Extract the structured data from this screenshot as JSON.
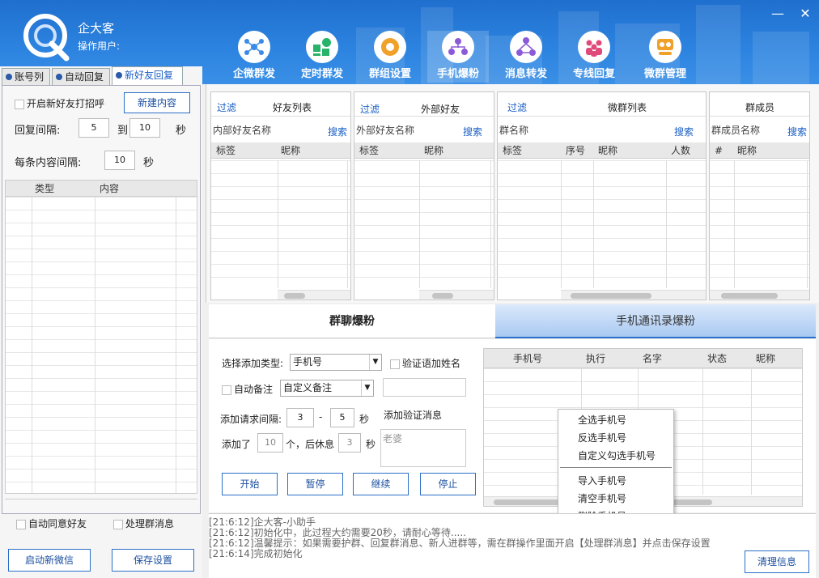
{
  "app": {
    "title": "企大客",
    "operator_label": "操作用户:",
    "minimize": "—",
    "close": "✕"
  },
  "nav": [
    {
      "label": "企微群发",
      "icon": "network-icon",
      "color": "#3a8be8"
    },
    {
      "label": "定时群发",
      "icon": "clock-grid-icon",
      "color": "#27b36a"
    },
    {
      "label": "群组设置",
      "icon": "gear-icon",
      "color": "#f0a12a"
    },
    {
      "label": "手机爆粉",
      "icon": "people-tree-icon",
      "color": "#8a5ad8"
    },
    {
      "label": "消息转发",
      "icon": "share-icon",
      "color": "#8a5ad8"
    },
    {
      "label": "专线回复",
      "icon": "team-icon",
      "color": "#e04a7a"
    },
    {
      "label": "微群管理",
      "icon": "group-manage-icon",
      "color": "#f0a12a"
    }
  ],
  "left": {
    "tabs": [
      "账号列",
      "自动回复",
      "新好友回复"
    ],
    "enable_greeting": "开启新好友打招呼",
    "new_content_button": "新建内容",
    "reply_interval_label": "回复间隔:",
    "reply_from": "5",
    "to_label": "到",
    "reply_to": "10",
    "sec": "秒",
    "content_interval_label": "每条内容间隔:",
    "content_interval": "10",
    "columns": [
      "类型",
      "内容"
    ],
    "auto_accept": "自动同意好友",
    "handle_group_msg": "处理群消息",
    "start_wechat": "启动新微信",
    "save_settings": "保存设置"
  },
  "panels": {
    "friends": {
      "filter": "过滤",
      "title": "好友列表",
      "search_label": "内部好友名称",
      "search": "搜索",
      "columns": [
        "标签",
        "昵称"
      ]
    },
    "external": {
      "filter": "过滤",
      "title": "外部好友",
      "search_label": "外部好友名称",
      "search": "搜索",
      "columns": [
        "标签",
        "昵称"
      ]
    },
    "groups": {
      "filter": "过滤",
      "title": "微群列表",
      "search_label": "群名称",
      "search": "搜索",
      "columns": [
        "标签",
        "序号",
        "昵称",
        "人数"
      ]
    },
    "members": {
      "title": "群成员",
      "search_label": "群成员名称",
      "search": "搜索",
      "columns": [
        "#",
        "昵称"
      ]
    }
  },
  "bottom_tabs": [
    "群聊爆粉",
    "手机通讯录爆粉"
  ],
  "form": {
    "add_type_label": "选择添加类型:",
    "add_type_value": "手机号",
    "verify_add_name": "验证语加姓名",
    "auto_remark": "自动备注",
    "remark_value": "自定义备注",
    "interval_label": "添加请求间隔:",
    "interval_from": "3",
    "dash": "-",
    "interval_to": "5",
    "sec": "秒",
    "verify_msg_label": "添加验证消息",
    "added_label": "添加了",
    "added_count": "10",
    "rest_label": "个，后休息",
    "rest_value": "3",
    "verify_msg_value": "老婆",
    "buttons": [
      "开始",
      "暂停",
      "继续",
      "停止"
    ]
  },
  "phone_table": {
    "columns": [
      "手机号",
      "执行",
      "名字",
      "状态",
      "昵称"
    ]
  },
  "context_menu": [
    "全选手机号",
    "反选手机号",
    "自定义勾选手机号",
    "导入手机号",
    "清空手机号",
    "删除手机号"
  ],
  "log": [
    "[21:6:12]企大客-小助手",
    "[21:6:12]初始化中，此过程大约需要20秒，请耐心等待.....",
    "[21:6:12]温馨提示：如果需要护群、回复群消息、新人进群等，需在群操作里面开启【处理群消息】并点击保存设置",
    "[21:6:14]完成初始化"
  ],
  "clear_button": "清理信息"
}
